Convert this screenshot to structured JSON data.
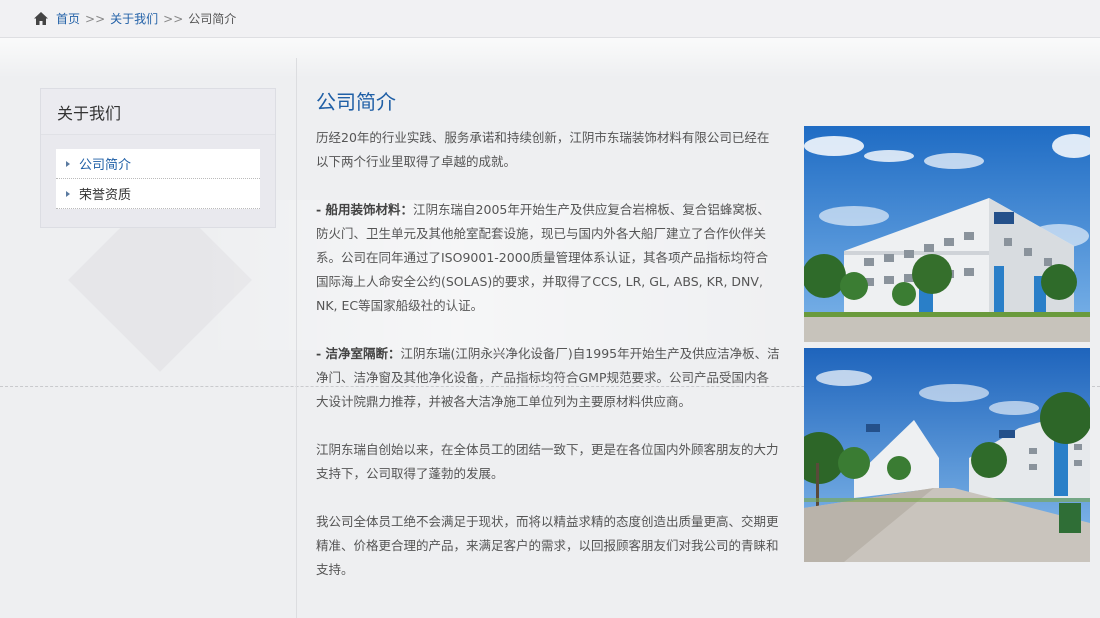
{
  "breadcrumb": {
    "home_icon": "home-icon",
    "items": [
      "首页",
      "关于我们",
      "公司简介"
    ],
    "separator": ">>"
  },
  "sidebar": {
    "title": "关于我们",
    "items": [
      {
        "label": "公司简介",
        "active": true
      },
      {
        "label": "荣誉资质",
        "active": false
      }
    ]
  },
  "main": {
    "title": "公司简介",
    "paragraphs": [
      {
        "lead": "",
        "text": "历经20年的行业实践、服务承诺和持续创新，江阴市东瑞装饰材料有限公司已经在以下两个行业里取得了卓越的成就。"
      },
      {
        "lead": "- 船用装饰材料：",
        "text": "江阴东瑞自2005年开始生产及供应复合岩棉板、复合铝蜂窝板、防火门、卫生单元及其他舱室配套设施，现已与国内外各大船厂建立了合作伙伴关系。公司在同年通过了ISO9001-2000质量管理体系认证，其各项产品指标均符合国际海上人命安全公约(SOLAS)的要求，并取得了CCS, LR, GL, ABS, KR, DNV, NK, EC等国家船级社的认证。"
      },
      {
        "lead": "- 洁净室隔断：",
        "text": "江阴东瑞(江阴永兴净化设备厂)自1995年开始生产及供应洁净板、洁净门、洁净窗及其他净化设备，产品指标均符合GMP规范要求。公司产品受国内各大设计院鼎力推荐，并被各大洁净施工单位列为主要原材料供应商。"
      },
      {
        "lead": "",
        "text": "江阴东瑞自创始以来，在全体员工的团结一致下，更是在各位国内外顾客朋友的大力支持下，公司取得了蓬勃的发展。"
      },
      {
        "lead": "",
        "text": "我公司全体员工绝不会满足于现状，而将以精益求精的态度创造出质量更高、交期更精准、价格更合理的产品，来满足客户的需求，以回报顾客朋友们对我公司的青睐和支持。"
      }
    ]
  },
  "colors": {
    "accent": "#1f5fa6",
    "sky": "#2d7fd0",
    "building": "#eef0f2",
    "blue_panel": "#2a7fc8"
  }
}
